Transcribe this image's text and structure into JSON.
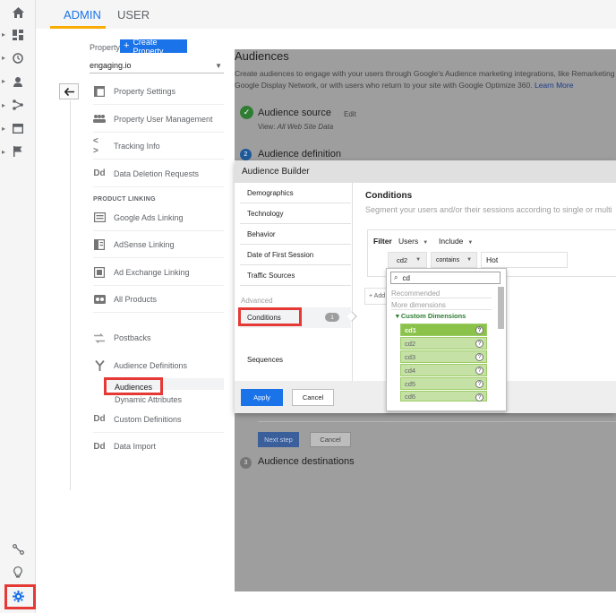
{
  "tabs": {
    "admin": "ADMIN",
    "user": "USER"
  },
  "property": {
    "label": "Property",
    "create_label": "Create Property",
    "selected": "engaging.io"
  },
  "menu": {
    "property_settings": "Property Settings",
    "user_management": "Property User Management",
    "tracking_info": "Tracking Info",
    "data_deletion": "Data Deletion Requests",
    "product_linking_heading": "PRODUCT LINKING",
    "google_ads": "Google Ads Linking",
    "adsense": "AdSense Linking",
    "ad_exchange": "Ad Exchange Linking",
    "all_products": "All Products",
    "postbacks": "Postbacks",
    "audience_definitions": "Audience Definitions",
    "audiences": "Audiences",
    "dynamic_attributes": "Dynamic Attributes",
    "custom_definitions": "Custom Definitions",
    "data_import": "Data Import",
    "dd_glyph": "Dd"
  },
  "audiences_page": {
    "title": "Audiences",
    "desc_line1": "Create audiences to engage with your users through Google's Audience marketing integrations, like Remarketing Li",
    "desc_line2": "Google Display Network, or with users who return to your site with Google Optimize 360.",
    "learn_more": "Learn More",
    "step1_title": "Audience source",
    "step1_edit": "Edit",
    "step1_view_label": "View:",
    "step1_view_value": "All Web Site Data",
    "step2_num": "2",
    "step2_title": "Audience definition",
    "next_step": "Next step",
    "cancel": "Cancel",
    "step3_num": "3",
    "step3_title": "Audience destinations"
  },
  "builder": {
    "title": "Audience Builder",
    "categories": [
      "Demographics",
      "Technology",
      "Behavior",
      "Date of First Session",
      "Traffic Sources"
    ],
    "advanced_label": "Advanced",
    "conditions": "Conditions",
    "conditions_count": "1",
    "sequences": "Sequences",
    "cond_title": "Conditions",
    "cond_sub": "Segment your users and/or their sessions according to single or multi",
    "filter_label": "Filter",
    "filter_scope": "Users",
    "filter_mode": "Include",
    "dimension": "cd2",
    "operator": "contains",
    "value": "Hot",
    "add_label": "+ Add",
    "apply": "Apply",
    "cancel": "Cancel"
  },
  "dropdown": {
    "search_value": "cd",
    "recommended": "Recommended",
    "more_dimensions": "More dimensions",
    "custom_dimensions": "▾ Custom Dimensions",
    "options": [
      "cd1",
      "cd2",
      "cd3",
      "cd4",
      "cd5",
      "cd6"
    ]
  },
  "colors": {
    "accent_blue": "#1a73e8",
    "highlight_red": "#e53935",
    "tab_underline": "#f9ab00",
    "option_green": "#c5e1a5"
  }
}
